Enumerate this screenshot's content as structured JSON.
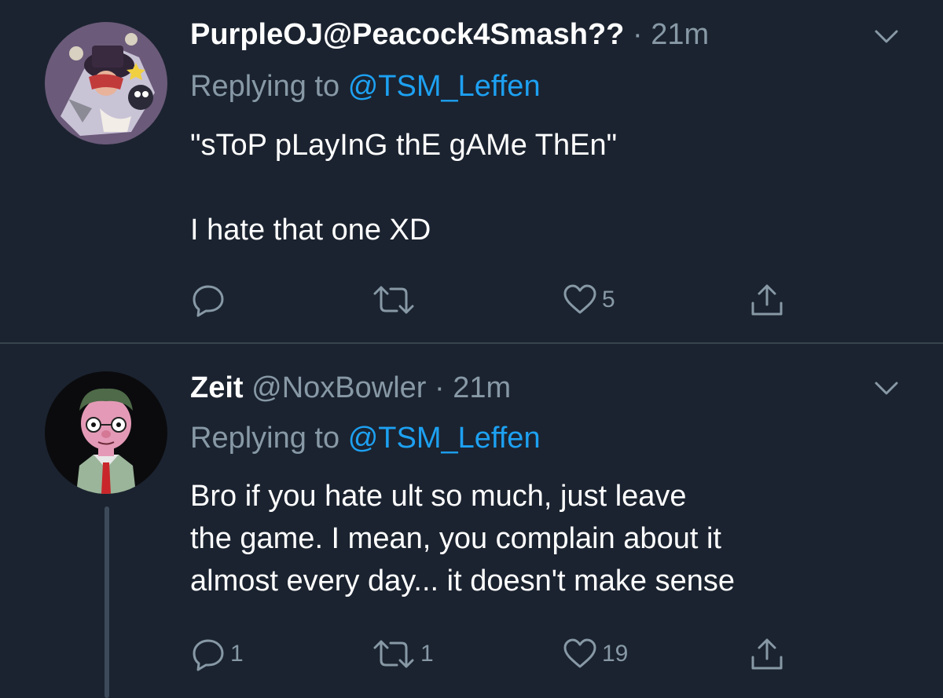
{
  "tweets": [
    {
      "name": "PurpleOJ@Peacock4Smash??",
      "handle": "",
      "separator": "·",
      "time": "21m",
      "replying_prefix": "Replying to",
      "replying_to": "@TSM_Leffen",
      "body": [
        "\"sToP pLayInG thE gAMe ThEn\"",
        "",
        "I hate that one XD"
      ],
      "actions": {
        "reply": {
          "icon": "reply-icon",
          "count": ""
        },
        "retweet": {
          "icon": "retweet-icon",
          "count": ""
        },
        "like": {
          "icon": "heart-icon",
          "count": "5"
        },
        "share": {
          "icon": "share-icon",
          "count": ""
        }
      }
    },
    {
      "name": "Zeit",
      "handle": "@NoxBowler",
      "separator": "·",
      "time": "21m",
      "replying_prefix": "Replying to",
      "replying_to": "@TSM_Leffen",
      "body": [
        "Bro if you hate ult so much, just leave",
        "the game. I mean, you complain about it",
        "almost every day... it doesn't make sense"
      ],
      "actions": {
        "reply": {
          "icon": "reply-icon",
          "count": "1"
        },
        "retweet": {
          "icon": "retweet-icon",
          "count": "1"
        },
        "like": {
          "icon": "heart-icon",
          "count": "19"
        },
        "share": {
          "icon": "share-icon",
          "count": ""
        }
      }
    }
  ],
  "colors": {
    "background": "#1b2330",
    "text_primary": "#ffffff",
    "text_secondary": "#8899a6",
    "link": "#1da1f2",
    "divider": "#38444d"
  }
}
